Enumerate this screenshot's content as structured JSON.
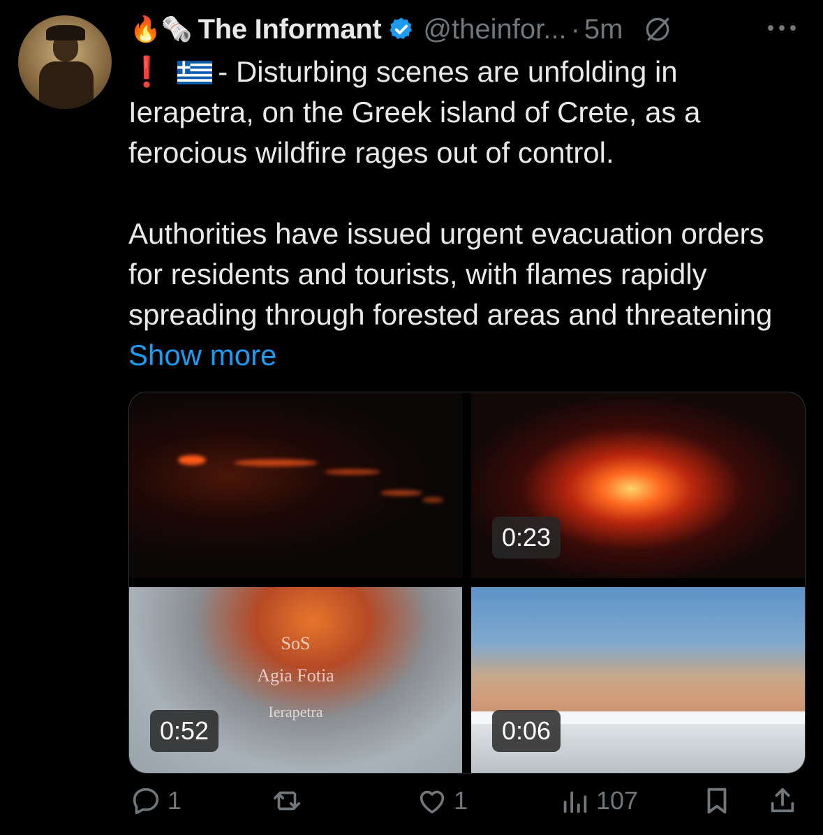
{
  "author": {
    "emojis": "🔥🗞️",
    "name": "The Informant",
    "handle": "@theinfor...",
    "time": "5m"
  },
  "tweet": {
    "line_prefix": "❗",
    "paragraph1_rest": "- Disturbing scenes are unfolding in Ierapetra, on the Greek island of Crete, as a ferocious wildfire rages out of control.",
    "paragraph2": "Authorities have issued urgent evacuation orders for residents and tourists, with flames rapidly spreading through forested areas and threatening",
    "show_more": "Show more"
  },
  "media": {
    "tiles": [
      {
        "duration": ""
      },
      {
        "duration": "0:23"
      },
      {
        "duration": "0:52",
        "overlay": [
          "SoS",
          "Agia Fotia",
          "Ierapetra"
        ]
      },
      {
        "duration": "0:06"
      }
    ]
  },
  "actions": {
    "replies": "1",
    "reposts": "",
    "likes": "1",
    "views": "107"
  },
  "colors": {
    "background": "#000000",
    "text": "#e7e9ea",
    "muted": "#71767b",
    "link": "#1d9bf0"
  },
  "icons": [
    "verified-badge-icon",
    "grok-icon",
    "more-icon",
    "reply-icon",
    "repost-icon",
    "like-icon",
    "views-icon",
    "bookmark-icon",
    "share-icon"
  ]
}
